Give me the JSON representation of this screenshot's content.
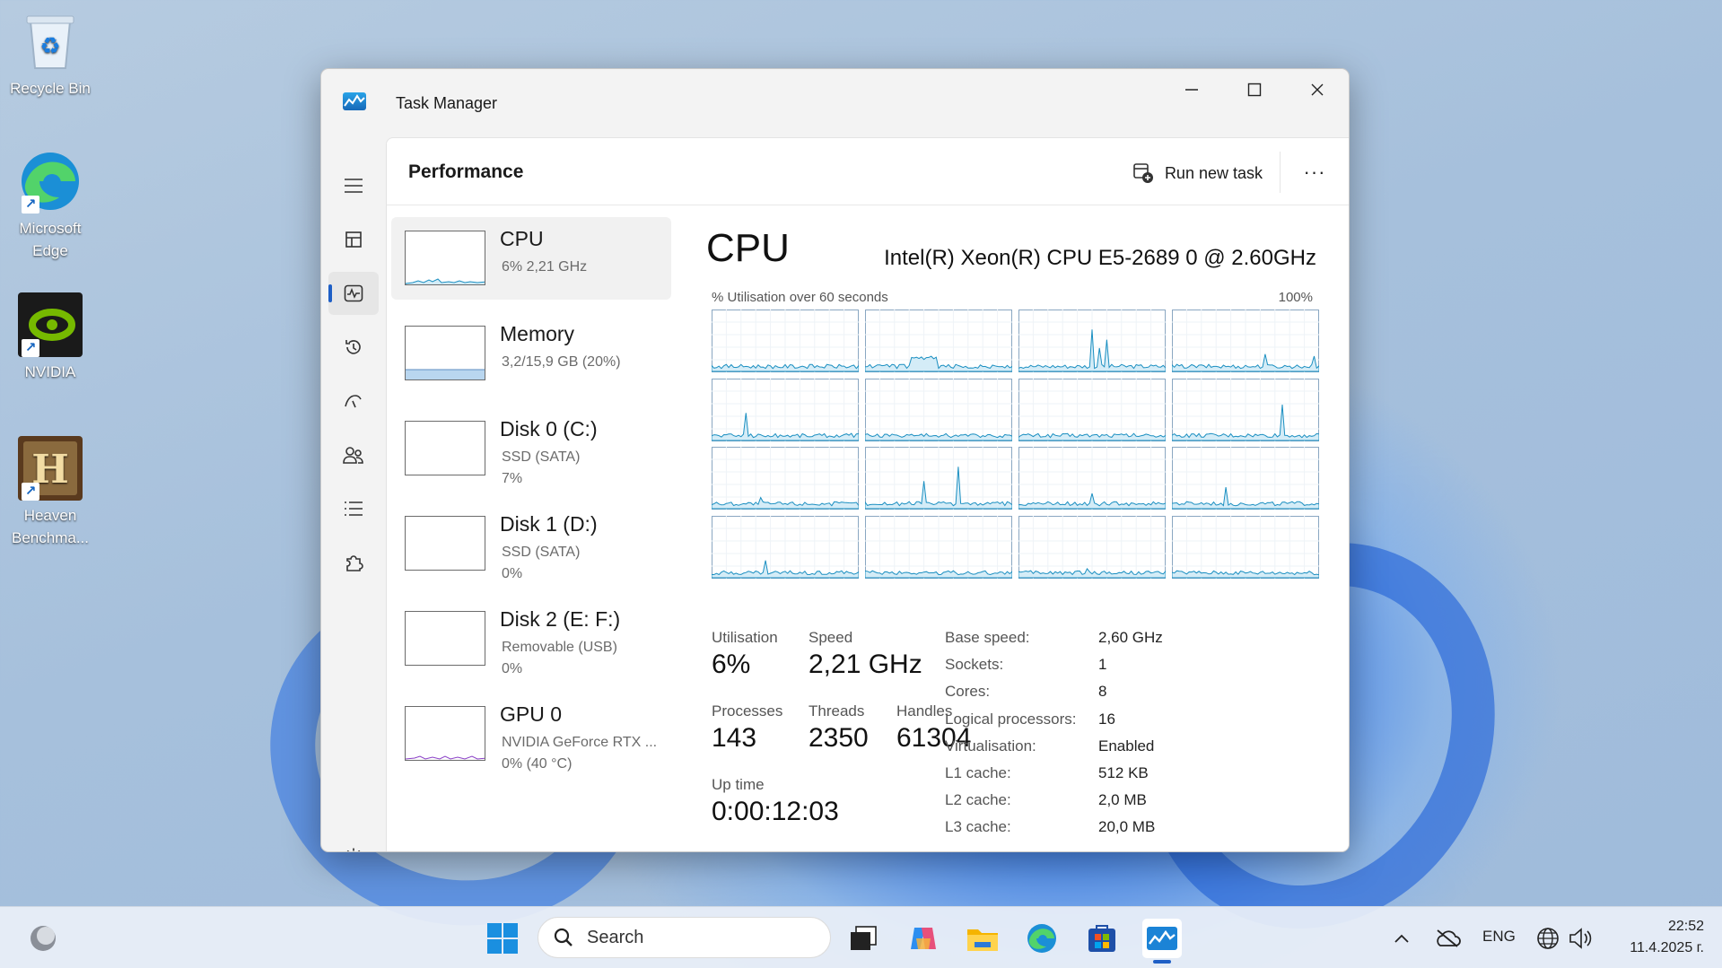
{
  "desktop": {
    "icons": [
      {
        "label": "Recycle Bin",
        "icon": "recycle-bin-icon"
      },
      {
        "label": "Microsoft Edge",
        "icon": "edge-icon"
      },
      {
        "label": "NVIDIA",
        "icon": "nvidia-icon"
      },
      {
        "label": "Heaven Benchma...",
        "icon": "heaven-benchmark-icon"
      }
    ]
  },
  "window": {
    "title": "Task Manager",
    "controls": [
      "minimize",
      "maximize",
      "close"
    ]
  },
  "header": {
    "page_title": "Performance",
    "run_new_task": "Run new task",
    "more": "···"
  },
  "sidebar": {
    "items": [
      {
        "name": "CPU",
        "sub1": "6% 2,21 GHz",
        "sub2": ""
      },
      {
        "name": "Memory",
        "sub1": "3,2/15,9 GB (20%)",
        "sub2": ""
      },
      {
        "name": "Disk 0 (C:)",
        "sub1": "SSD (SATA)",
        "sub2": "7%"
      },
      {
        "name": "Disk 1 (D:)",
        "sub1": "SSD (SATA)",
        "sub2": "0%"
      },
      {
        "name": "Disk 2 (E: F:)",
        "sub1": "Removable (USB)",
        "sub2": "0%"
      },
      {
        "name": "GPU 0",
        "sub1": "NVIDIA GeForce RTX ...",
        "sub2": "0% (40 °C)"
      }
    ]
  },
  "cpu": {
    "title": "CPU",
    "model": "Intel(R) Xeon(R) CPU E5-2689 0 @ 2.60GHz",
    "graph_label": "% Utilisation over 60 seconds",
    "graph_max": "100%",
    "stats": {
      "utilisation_label": "Utilisation",
      "utilisation": "6%",
      "speed_label": "Speed",
      "speed": "2,21 GHz",
      "processes_label": "Processes",
      "processes": "143",
      "threads_label": "Threads",
      "threads": "2350",
      "handles_label": "Handles",
      "handles": "61304",
      "uptime_label": "Up time",
      "uptime": "0:00:12:03"
    },
    "specs": [
      {
        "label": "Base speed:",
        "value": "2,60 GHz"
      },
      {
        "label": "Sockets:",
        "value": "1"
      },
      {
        "label": "Cores:",
        "value": "8"
      },
      {
        "label": "Logical processors:",
        "value": "16"
      },
      {
        "label": "Virtualisation:",
        "value": "Enabled"
      },
      {
        "label": "L1 cache:",
        "value": "512 KB"
      },
      {
        "label": "L2 cache:",
        "value": "2,0 MB"
      },
      {
        "label": "L3 cache:",
        "value": "20,0 MB"
      }
    ]
  },
  "taskbar": {
    "search_placeholder": "Search",
    "language": "ENG",
    "time": "22:52",
    "date": "11.4.2025 г."
  },
  "colors": {
    "accent": "#1e5fc6",
    "graph_line": "#1b8fc1",
    "graph_fill": "#d4ecf7",
    "memory_fill": "#b9d6ef"
  }
}
